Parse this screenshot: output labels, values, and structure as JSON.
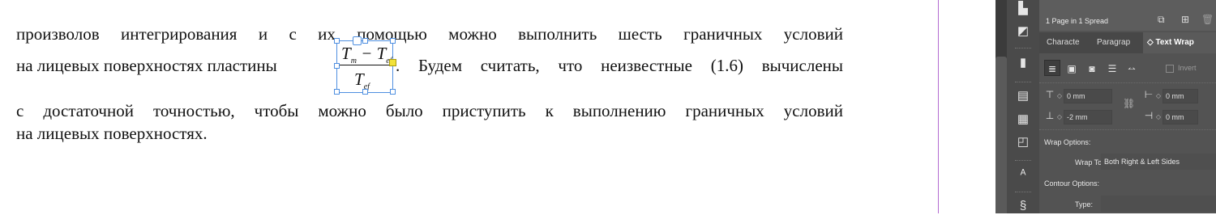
{
  "document": {
    "line1": "произволов интегрирования и с их помощью можно выполнить шесть граничных условий",
    "line2_before": "на лицевых поверхностях пластины",
    "line2_after": ". Будем считать, что неизвестные (1.6) вычислены",
    "line3": "с достаточной точностью, чтобы можно было приступить к выполнению граничных условий",
    "line4": "на лицевых поверхностях.",
    "formula": {
      "num_a": "T",
      "num_a_sub": "m",
      "minus": " − ",
      "num_b": "T",
      "num_b_sub": "ef",
      "den": "T",
      "den_sub": "ef"
    }
  },
  "dock": {
    "icons": [
      "align-icon",
      "layers-icon",
      "bookmark-icon",
      "table-icon",
      "table-styles-icon",
      "cell-styles-icon",
      "paragraph-styles-icon",
      "character-styles-icon"
    ]
  },
  "panel": {
    "pages_info": "1 Page in 1 Spread",
    "tabs": [
      "Characte",
      "Paragrap",
      "◇ Text Wrap"
    ],
    "invert_label": "Invert",
    "top_offset": "0 mm",
    "bottom_offset": "-2 mm",
    "left_offset": "0 mm",
    "right_offset": "0 mm",
    "wrap_options_label": "Wrap Options:",
    "wrap_to_label": "Wrap To:",
    "wrap_to_value": "Both Right & Left Sides",
    "contour_options_label": "Contour Options:",
    "type_label": "Type:"
  }
}
